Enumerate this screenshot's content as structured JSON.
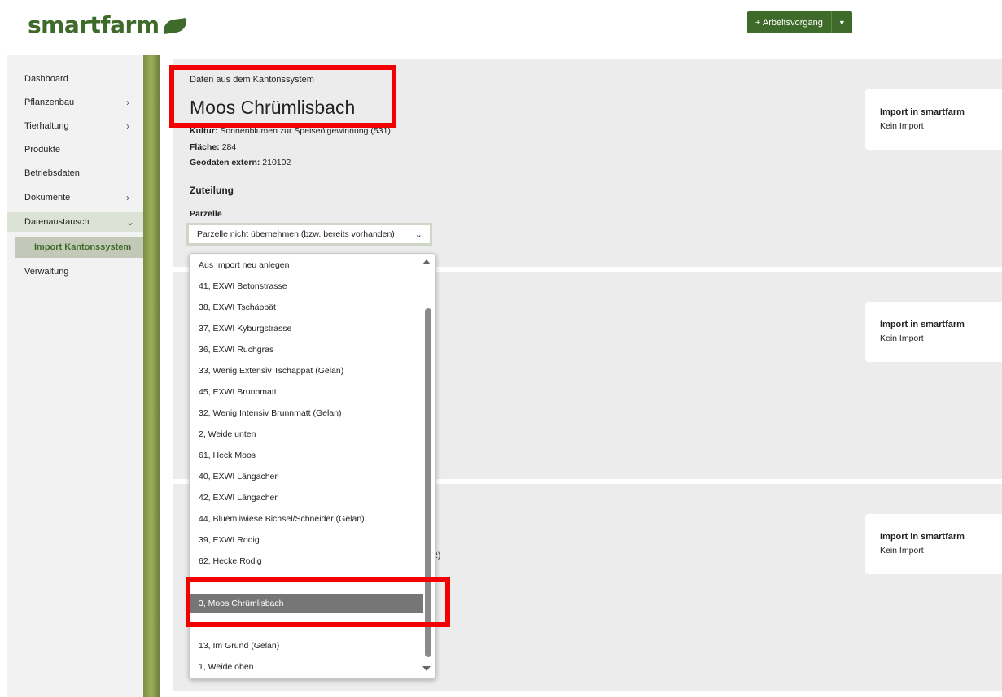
{
  "header": {
    "logo": "smartfarm",
    "action_button": "+ Arbeitsvorgang"
  },
  "sidebar": {
    "items": [
      {
        "label": "Dashboard",
        "chevron": ""
      },
      {
        "label": "Pflanzenbau",
        "chevron": ">"
      },
      {
        "label": "Tierhaltung",
        "chevron": ">"
      },
      {
        "label": "Produkte",
        "chevron": ""
      },
      {
        "label": "Betriebsdaten",
        "chevron": ""
      },
      {
        "label": "Dokumente",
        "chevron": ">"
      },
      {
        "label": "Datenaustausch",
        "chevron": "v"
      },
      {
        "label": "Import Kantonssystem",
        "chevron": ""
      },
      {
        "label": "Verwaltung",
        "chevron": ""
      }
    ]
  },
  "record": {
    "source_label": "Daten aus dem Kantonssystem",
    "title": "Moos Chrümlisbach",
    "kultur_label": "Kultur:",
    "kultur_value": "Sonnenblumen zur Speiseölgewinnung (531)",
    "flaeche_label": "Fläche:",
    "flaeche_value": "284",
    "geodaten_label": "Geodaten extern:",
    "geodaten_value": "210102",
    "section": "Zuteilung",
    "parzelle_label": "Parzelle",
    "parzelle_selected": "Parzelle nicht übernehmen (bzw. bereits vorhanden)"
  },
  "import_cards": [
    {
      "title": "Import in smartfarm",
      "value": "Kein Import"
    },
    {
      "title": "Import in smartfarm",
      "value": "Kein Import"
    },
    {
      "title": "Import in smartfarm",
      "value": "Kein Import"
    }
  ],
  "dropdown": {
    "options": [
      "Aus Import neu anlegen",
      "41, EXWI Betonstrasse",
      "38, EXWI Tschäppät",
      "37, EXWI Kyburgstrasse",
      "36, EXWI Ruchgras",
      "33, Wenig Extensiv Tschäppät (Gelan)",
      "45, EXWI Brunnmatt",
      "32, Wenig Intensiv Brunnmatt (Gelan)",
      "2, Weide unten",
      "61, Heck Moos",
      "40, EXWI Längacher",
      "42, EXWI Längacher",
      "44, Blüemliwiese Bichsel/Schneider (Gelan)",
      "39, EXWI Rodig",
      "62, Hecke Rodig",
      "",
      "3, Moos Chrümlisbach",
      "",
      "13, Im Grund (Gelan)",
      "1, Weide oben"
    ],
    "selected_index": 16
  },
  "partial_text": "2)"
}
